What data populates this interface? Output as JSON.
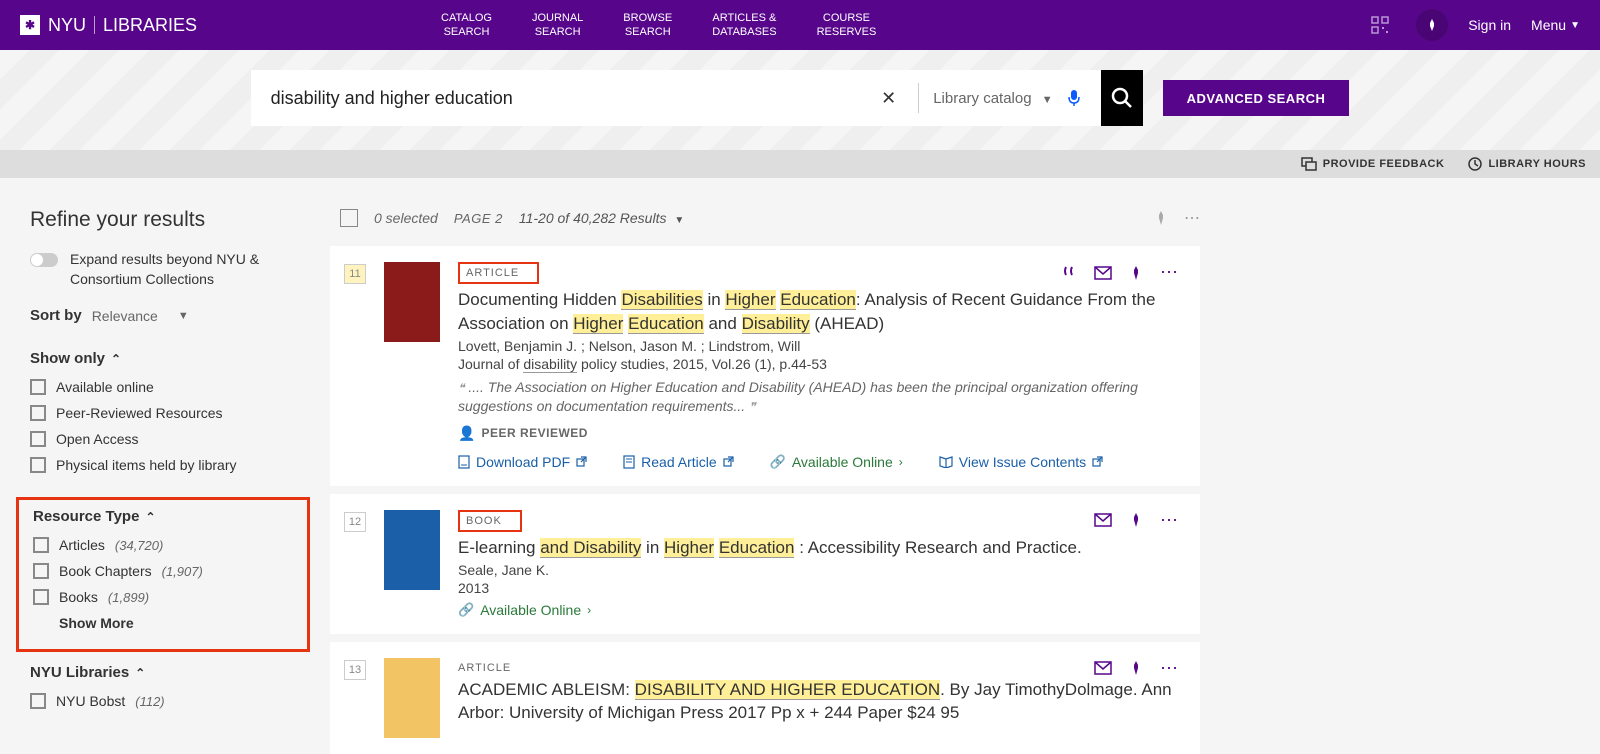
{
  "brand": {
    "logo_text": "NYU",
    "logo_suffix": "LIBRARIES"
  },
  "nav": [
    {
      "line1": "CATALOG",
      "line2": "SEARCH"
    },
    {
      "line1": "JOURNAL",
      "line2": "SEARCH"
    },
    {
      "line1": "BROWSE",
      "line2": "SEARCH"
    },
    {
      "line1": "ARTICLES &",
      "line2": "DATABASES"
    },
    {
      "line1": "COURSE",
      "line2": "RESERVES"
    }
  ],
  "topbar": {
    "signin": "Sign in",
    "menu": "Menu"
  },
  "search": {
    "query": "disability and higher education",
    "scope": "Library catalog",
    "advanced": "ADVANCED SEARCH"
  },
  "subbar": {
    "feedback": "PROVIDE FEEDBACK",
    "hours": "LIBRARY HOURS"
  },
  "refine": {
    "title": "Refine your results",
    "expand": "Expand results beyond NYU & Consortium Collections",
    "sort_label": "Sort by",
    "sort_value": "Relevance",
    "show_only": {
      "title": "Show only",
      "items": [
        "Available online",
        "Peer-Reviewed Resources",
        "Open Access",
        "Physical items held by library"
      ]
    },
    "resource_type": {
      "title": "Resource Type",
      "items": [
        {
          "label": "Articles",
          "count": "(34,720)"
        },
        {
          "label": "Book Chapters",
          "count": "(1,907)"
        },
        {
          "label": "Books",
          "count": "(1,899)"
        }
      ],
      "show_more": "Show More"
    },
    "nyu_libraries": {
      "title": "NYU Libraries",
      "items": [
        {
          "label": "NYU Bobst",
          "count": "(112)"
        }
      ]
    }
  },
  "results_header": {
    "selected": "0 selected",
    "page": "PAGE 2",
    "range": "11-20 of 40,282 Results"
  },
  "results": [
    {
      "num": "11",
      "type": "ARTICLE",
      "redbox": true,
      "thumb": "red",
      "title_parts": [
        "Documenting Hidden ",
        "Disabilities",
        " in ",
        "Higher",
        " ",
        "Education",
        ": Analysis of Recent Guidance From the Association on ",
        "Higher",
        " ",
        "Education",
        " and ",
        "Disability",
        " (AHEAD)"
      ],
      "authors": "Lovett, Benjamin J. ; Nelson, Jason M. ; Lindstrom, Will",
      "source_pre": "Journal of ",
      "source_hl": "disability",
      "source_post": " policy studies, 2015, Vol.26 (1), p.44-53",
      "snippet": ".... The Association on Higher Education and Disability (AHEAD) has been the principal organization offering suggestions on documentation requirements...",
      "peer": "PEER REVIEWED",
      "actions": [
        {
          "label": "Download PDF",
          "icon": "pdf",
          "ext": true,
          "color": "blue"
        },
        {
          "label": "Read Article",
          "icon": "doc",
          "ext": true,
          "color": "blue"
        },
        {
          "label": "Available Online",
          "icon": "link",
          "chev": true,
          "color": "green"
        },
        {
          "label": "View Issue Contents",
          "icon": "book",
          "ext": true,
          "color": "blue"
        }
      ],
      "icons": [
        "cite",
        "mail",
        "pin",
        "dots"
      ]
    },
    {
      "num": "12",
      "type": "BOOK",
      "redbox": true,
      "thumb": "blue",
      "title_parts": [
        "E-learning ",
        "and Disability",
        " in ",
        "Higher",
        " ",
        "Education",
        " : Accessibility Research and Practice."
      ],
      "authors": "Seale, Jane K.",
      "source_post": "2013",
      "actions": [
        {
          "label": "Available Online",
          "icon": "link",
          "chev": true,
          "color": "green"
        }
      ],
      "icons": [
        "mail",
        "pin",
        "dots"
      ]
    },
    {
      "num": "13",
      "type": "ARTICLE",
      "redbox": false,
      "thumb": "orange",
      "title_parts": [
        "ACADEMIC ABLEISM: ",
        "DISABILITY AND HIGHER EDUCATION",
        ". By Jay TimothyDolmage. Ann Arbor: University of Michigan Press  2017  Pp  x + 244  Paper  $24 95"
      ],
      "icons": [
        "mail",
        "pin",
        "dots"
      ]
    }
  ]
}
